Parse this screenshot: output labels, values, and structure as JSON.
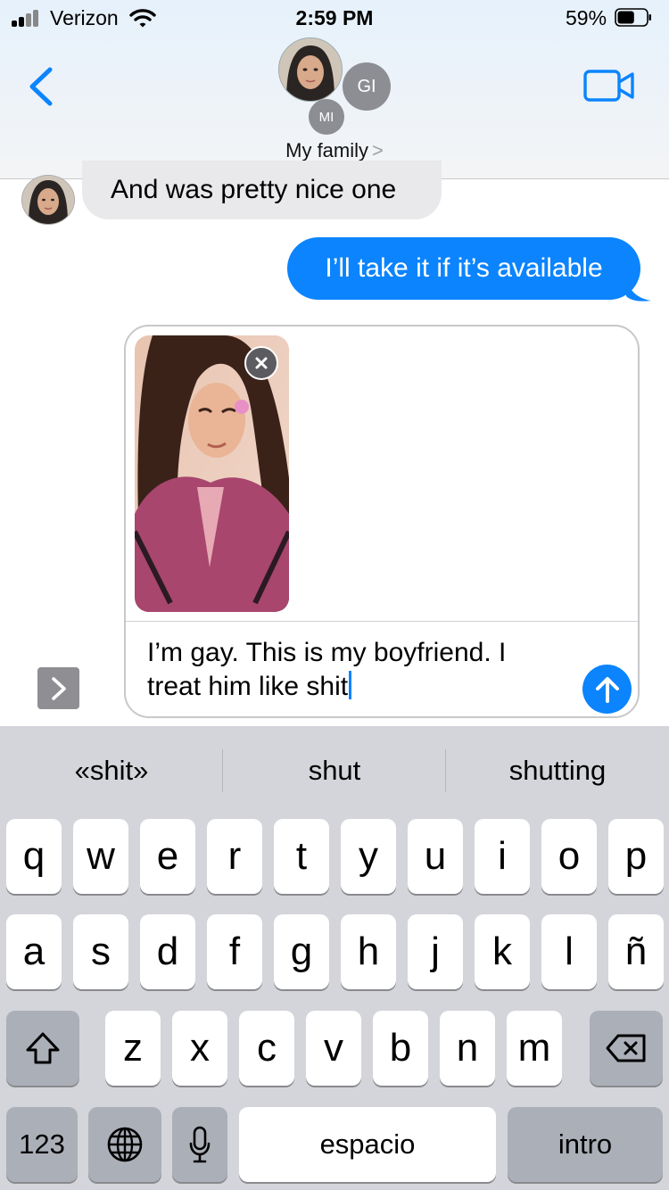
{
  "status_bar": {
    "carrier": "Verizon",
    "time": "2:59 PM",
    "battery_percent": "59%",
    "battery_level": 0.59
  },
  "header": {
    "group_name": "My family",
    "group_chevron": ">",
    "avatar_initials": [
      "GI",
      "MI"
    ],
    "back_icon": "chevron-left-icon",
    "video_icon": "video-camera-icon"
  },
  "messages": [
    {
      "direction": "incoming",
      "text": "And was pretty nice one"
    },
    {
      "direction": "outgoing",
      "text": "I’ll take it if it’s available"
    }
  ],
  "compose": {
    "attachment": "photo",
    "text": "I’m gay. This is my boyfriend. I treat him like shit",
    "send_icon": "arrow-up-icon",
    "expand_icon": "chevron-right-icon",
    "remove_icon": "close-icon"
  },
  "keyboard": {
    "suggestions": [
      "«shit»",
      "shut",
      "shutting"
    ],
    "row1": [
      "q",
      "w",
      "e",
      "r",
      "t",
      "y",
      "u",
      "i",
      "o",
      "p"
    ],
    "row2": [
      "a",
      "s",
      "d",
      "f",
      "g",
      "h",
      "j",
      "k",
      "l",
      "ñ"
    ],
    "row3": [
      "z",
      "x",
      "c",
      "v",
      "b",
      "n",
      "m"
    ],
    "numbers_label": "123",
    "space_label": "espacio",
    "return_label": "intro",
    "shift_icon": "shift-icon",
    "delete_icon": "delete-icon",
    "globe_icon": "globe-icon",
    "mic_icon": "microphone-icon"
  },
  "colors": {
    "accent": "#0b84fe",
    "incoming_bubble": "#e9e9eb",
    "keyboard_bg": "#d3d5da"
  }
}
